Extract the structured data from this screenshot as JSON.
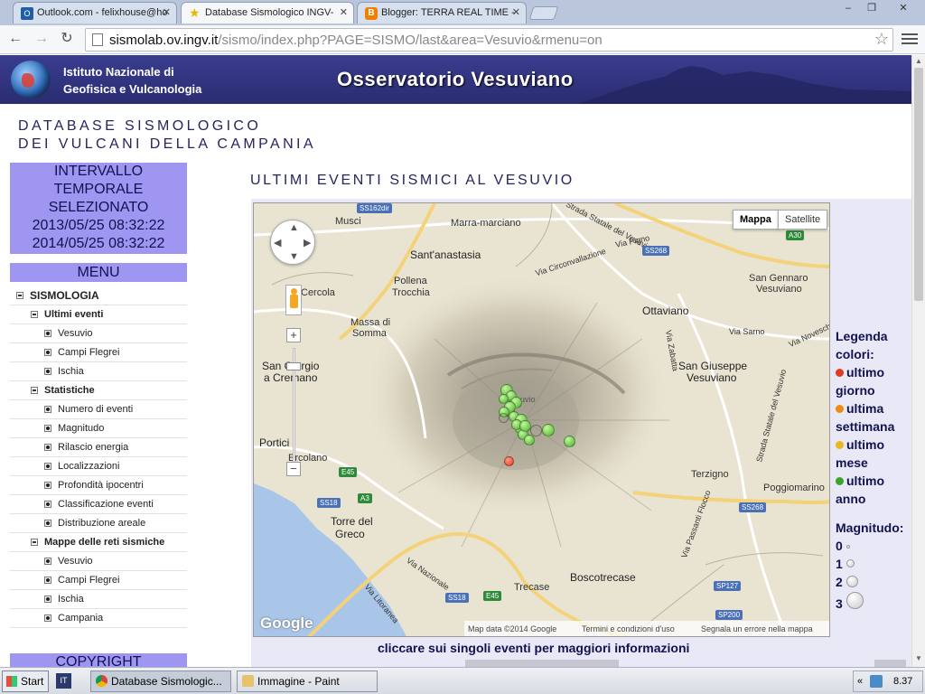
{
  "browser": {
    "tabs": [
      {
        "title": "Outlook.com - felixhouse@ho",
        "icon": "outlook-icon",
        "active": false
      },
      {
        "title": "Database Sismologico INGV-",
        "icon": "star-icon",
        "active": true
      },
      {
        "title": "Blogger: TERRA REAL TIME -",
        "icon": "blogger-icon",
        "active": false
      }
    ],
    "url_host": "sismolab.ov.ingv.it",
    "url_path": "/sismo/index.php?PAGE=SISMO/last&area=Vesuvio&rmenu=on",
    "window_buttons": [
      "–",
      "❐",
      "✕"
    ]
  },
  "banner": {
    "institute_line1": "Istituto Nazionale di",
    "institute_line2": "Geofisica e Vulcanologia",
    "observatory": "Osservatorio Vesuviano"
  },
  "page": {
    "db_title_line1": "DATABASE SISMOLOGICO",
    "db_title_line2": "DEI VULCANI DELLA CAMPANIA",
    "interval_line1": "INTERVALLO",
    "interval_line2": "TEMPORALE",
    "interval_line3": "SELEZIONATO",
    "interval_from": "2013/05/25 08:32:22",
    "interval_to": "2014/05/25 08:32:22",
    "menu_title": "MENU",
    "copyright": "COPYRIGHT",
    "events_title": "ULTIMI EVENTI SISMICI AL VESUVIO",
    "click_hint": "cliccare sui singoli eventi per maggiori informazioni"
  },
  "menu": [
    {
      "level": 0,
      "label": "SISMOLOGIA"
    },
    {
      "level": 1,
      "label": "Ultimi eventi"
    },
    {
      "level": 2,
      "label": "Vesuvio"
    },
    {
      "level": 2,
      "label": "Campi Flegrei"
    },
    {
      "level": 2,
      "label": "Ischia"
    },
    {
      "level": 1,
      "label": "Statistiche"
    },
    {
      "level": 2,
      "label": "Numero di eventi"
    },
    {
      "level": 2,
      "label": "Magnitudo"
    },
    {
      "level": 2,
      "label": "Rilascio energia"
    },
    {
      "level": 2,
      "label": "Localizzazioni"
    },
    {
      "level": 2,
      "label": "Profondità ipocentri"
    },
    {
      "level": 2,
      "label": "Classificazione eventi"
    },
    {
      "level": 2,
      "label": "Distribuzione areale"
    },
    {
      "level": 1,
      "label": "Mappe delle reti sismiche"
    },
    {
      "level": 2,
      "label": "Vesuvio"
    },
    {
      "level": 2,
      "label": "Campi Flegrei"
    },
    {
      "level": 2,
      "label": "Ischia"
    },
    {
      "level": 2,
      "label": "Campania"
    }
  ],
  "map": {
    "type_buttons": {
      "map": "Mappa",
      "satellite": "Satellite"
    },
    "zoom_in": "+",
    "zoom_out": "−",
    "logo": "Google",
    "footer": {
      "data": "Map data ©2014 Google",
      "terms": "Termini e condizioni d'uso",
      "report": "Segnala un errore nella mappa"
    },
    "places": {
      "musci": "Musci",
      "marra": "Marra-marciano",
      "santanastasia": "Sant'anastasia",
      "vigno": "Via Pigno",
      "circonv": "Via Circonvallazione",
      "pollena": "Pollena",
      "trocchia": "Trocchia",
      "cercola": "Cercola",
      "massa": "Massa di",
      "somma": "Somma",
      "ottaviano": "Ottaviano",
      "sgennaro1": "San Gennaro",
      "sgennaro2": "Vesuviano",
      "sgiorgio1": "San Giorgio",
      "sgiorgio2": "a Cremano",
      "sgiuseppe1": "San Giuseppe",
      "sgiuseppe2": "Vesuviano",
      "portici": "Portici",
      "ercolano": "Ercolano",
      "torre1": "Torre del",
      "torre2": "Greco",
      "terzigno": "Terzigno",
      "poggiomarino": "Poggiomarino",
      "boscotrecase": "Boscotrecase",
      "trecase": "Trecase",
      "vesuvio": "Vesuvio",
      "viasarno": "Via Sarno",
      "vianovesche": "Via Novesche",
      "viazabatta": "Via Zabatta",
      "viapassanti": "Via Passanti Flocco",
      "ssvesuvio": "Strada Statale del Vesuvio",
      "vianazionale": "Via Nazionale",
      "strada162": "Strada Statale del Vesuvio",
      "vialitoranea": "Via Litoranea"
    },
    "shields": {
      "ss162": "SS162dir",
      "a30": "A30",
      "ss268a": "SS268",
      "ss268b": "SS268",
      "e45a": "E45",
      "e45b": "E45",
      "ss18a": "SS18",
      "ss18b": "SS18",
      "a3": "A3",
      "sp127": "SP127",
      "sp200": "SP200"
    },
    "event_points": [
      {
        "mag": 1.5,
        "period": "anno"
      },
      {
        "mag": 1.2,
        "period": "anno"
      },
      {
        "mag": 1.0,
        "period": "anno"
      },
      {
        "mag": 1.3,
        "period": "anno"
      },
      {
        "mag": 1.4,
        "period": "anno"
      },
      {
        "mag": 1.1,
        "period": "anno"
      },
      {
        "mag": 1.0,
        "period": "settimana"
      },
      {
        "mag": 1.2,
        "period": "anno"
      },
      {
        "mag": 1.6,
        "period": "anno"
      },
      {
        "mag": 1.3,
        "period": "settimana"
      },
      {
        "mag": 1.0,
        "period": "anno"
      },
      {
        "mag": 1.1,
        "period": "anno"
      },
      {
        "mag": 1.2,
        "period": "anno"
      },
      {
        "mag": 1.5,
        "period": "anno"
      },
      {
        "mag": 1.3,
        "period": "anno"
      },
      {
        "mag": 1.0,
        "period": "giorno"
      },
      {
        "mag": 1.2,
        "period": "anno"
      },
      {
        "mag": 1.4,
        "period": "anno"
      }
    ]
  },
  "legend": {
    "title1": "Legenda",
    "title2": "colori:",
    "giorno1": "ultimo",
    "giorno2": "giorno",
    "settimana1": "ultima",
    "settimana2": "settimana",
    "mese1": "ultimo",
    "mese2": "mese",
    "anno1": "ultimo",
    "anno2": "anno",
    "magnitudo": "Magnitudo:",
    "mag0": "0",
    "mag1": "1",
    "mag2": "2",
    "mag3": "3",
    "colors": {
      "giorno": "#e23b1f",
      "settimana": "#f08a13",
      "mese": "#e8b81c",
      "anno": "#3aa52a"
    }
  },
  "taskbar": {
    "start": "Start",
    "quicklaunch": "IT",
    "tasks": [
      {
        "label": "Database Sismologic...",
        "icon": "chrome-icon",
        "active": true
      },
      {
        "label": "Immagine - Paint",
        "icon": "paint-icon",
        "active": false
      }
    ],
    "tray_arrow": "«",
    "clock": "8.37"
  }
}
